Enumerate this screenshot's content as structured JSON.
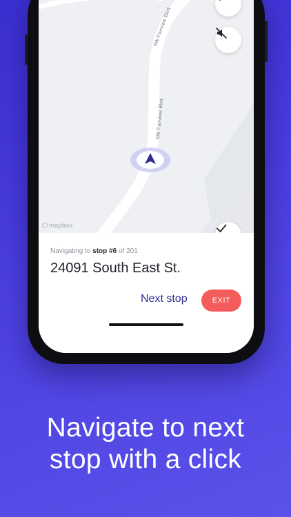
{
  "map": {
    "street_label_top": "SW Fairview Blvd",
    "street_label_bottom": "SW Fairview Blvd",
    "attribution": "mapbox",
    "buttons": {
      "reroute_icon": "swap-arrows-icon",
      "mute_icon": "speaker-muted-icon",
      "complete_icon": "checkmark-icon"
    }
  },
  "navigation": {
    "prefix": "Navigating to",
    "stop_label": "stop #6",
    "of_label": "of 201",
    "address": "24091 South East  St.",
    "next_stop_label": "Next stop",
    "exit_label": "EXIT"
  },
  "promo": {
    "line1": "Navigate to next",
    "line2": "stop with a click"
  },
  "colors": {
    "background": "#4a3fe0",
    "accent": "#2e2a8f",
    "exit": "#f45b5b",
    "location_puck": "#2e2a8f"
  }
}
